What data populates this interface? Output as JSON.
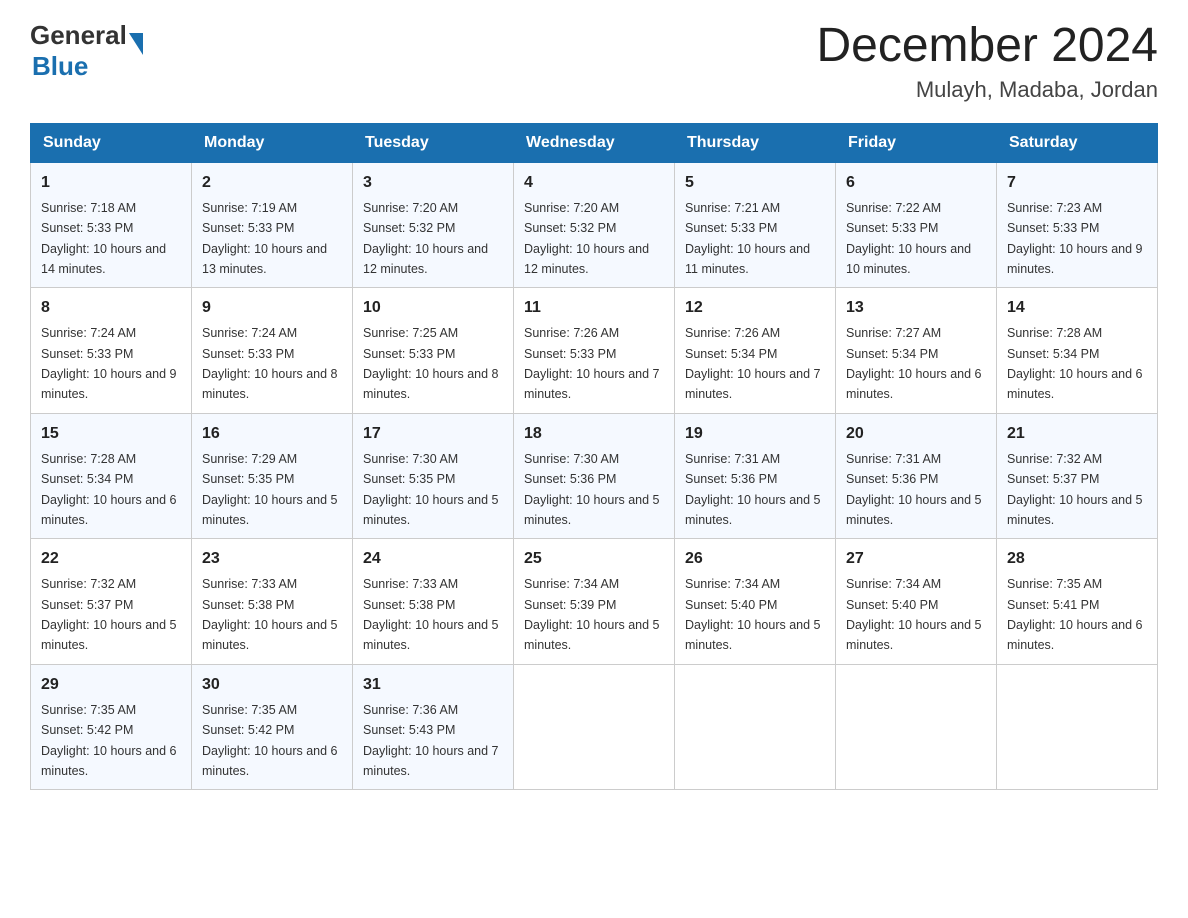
{
  "header": {
    "logo_general": "General",
    "logo_blue": "Blue",
    "month_title": "December 2024",
    "location": "Mulayh, Madaba, Jordan"
  },
  "days_of_week": [
    "Sunday",
    "Monday",
    "Tuesday",
    "Wednesday",
    "Thursday",
    "Friday",
    "Saturday"
  ],
  "weeks": [
    [
      {
        "day": "1",
        "sunrise": "7:18 AM",
        "sunset": "5:33 PM",
        "daylight": "10 hours and 14 minutes."
      },
      {
        "day": "2",
        "sunrise": "7:19 AM",
        "sunset": "5:33 PM",
        "daylight": "10 hours and 13 minutes."
      },
      {
        "day": "3",
        "sunrise": "7:20 AM",
        "sunset": "5:32 PM",
        "daylight": "10 hours and 12 minutes."
      },
      {
        "day": "4",
        "sunrise": "7:20 AM",
        "sunset": "5:32 PM",
        "daylight": "10 hours and 12 minutes."
      },
      {
        "day": "5",
        "sunrise": "7:21 AM",
        "sunset": "5:33 PM",
        "daylight": "10 hours and 11 minutes."
      },
      {
        "day": "6",
        "sunrise": "7:22 AM",
        "sunset": "5:33 PM",
        "daylight": "10 hours and 10 minutes."
      },
      {
        "day": "7",
        "sunrise": "7:23 AM",
        "sunset": "5:33 PM",
        "daylight": "10 hours and 9 minutes."
      }
    ],
    [
      {
        "day": "8",
        "sunrise": "7:24 AM",
        "sunset": "5:33 PM",
        "daylight": "10 hours and 9 minutes."
      },
      {
        "day": "9",
        "sunrise": "7:24 AM",
        "sunset": "5:33 PM",
        "daylight": "10 hours and 8 minutes."
      },
      {
        "day": "10",
        "sunrise": "7:25 AM",
        "sunset": "5:33 PM",
        "daylight": "10 hours and 8 minutes."
      },
      {
        "day": "11",
        "sunrise": "7:26 AM",
        "sunset": "5:33 PM",
        "daylight": "10 hours and 7 minutes."
      },
      {
        "day": "12",
        "sunrise": "7:26 AM",
        "sunset": "5:34 PM",
        "daylight": "10 hours and 7 minutes."
      },
      {
        "day": "13",
        "sunrise": "7:27 AM",
        "sunset": "5:34 PM",
        "daylight": "10 hours and 6 minutes."
      },
      {
        "day": "14",
        "sunrise": "7:28 AM",
        "sunset": "5:34 PM",
        "daylight": "10 hours and 6 minutes."
      }
    ],
    [
      {
        "day": "15",
        "sunrise": "7:28 AM",
        "sunset": "5:34 PM",
        "daylight": "10 hours and 6 minutes."
      },
      {
        "day": "16",
        "sunrise": "7:29 AM",
        "sunset": "5:35 PM",
        "daylight": "10 hours and 5 minutes."
      },
      {
        "day": "17",
        "sunrise": "7:30 AM",
        "sunset": "5:35 PM",
        "daylight": "10 hours and 5 minutes."
      },
      {
        "day": "18",
        "sunrise": "7:30 AM",
        "sunset": "5:36 PM",
        "daylight": "10 hours and 5 minutes."
      },
      {
        "day": "19",
        "sunrise": "7:31 AM",
        "sunset": "5:36 PM",
        "daylight": "10 hours and 5 minutes."
      },
      {
        "day": "20",
        "sunrise": "7:31 AM",
        "sunset": "5:36 PM",
        "daylight": "10 hours and 5 minutes."
      },
      {
        "day": "21",
        "sunrise": "7:32 AM",
        "sunset": "5:37 PM",
        "daylight": "10 hours and 5 minutes."
      }
    ],
    [
      {
        "day": "22",
        "sunrise": "7:32 AM",
        "sunset": "5:37 PM",
        "daylight": "10 hours and 5 minutes."
      },
      {
        "day": "23",
        "sunrise": "7:33 AM",
        "sunset": "5:38 PM",
        "daylight": "10 hours and 5 minutes."
      },
      {
        "day": "24",
        "sunrise": "7:33 AM",
        "sunset": "5:38 PM",
        "daylight": "10 hours and 5 minutes."
      },
      {
        "day": "25",
        "sunrise": "7:34 AM",
        "sunset": "5:39 PM",
        "daylight": "10 hours and 5 minutes."
      },
      {
        "day": "26",
        "sunrise": "7:34 AM",
        "sunset": "5:40 PM",
        "daylight": "10 hours and 5 minutes."
      },
      {
        "day": "27",
        "sunrise": "7:34 AM",
        "sunset": "5:40 PM",
        "daylight": "10 hours and 5 minutes."
      },
      {
        "day": "28",
        "sunrise": "7:35 AM",
        "sunset": "5:41 PM",
        "daylight": "10 hours and 6 minutes."
      }
    ],
    [
      {
        "day": "29",
        "sunrise": "7:35 AM",
        "sunset": "5:42 PM",
        "daylight": "10 hours and 6 minutes."
      },
      {
        "day": "30",
        "sunrise": "7:35 AM",
        "sunset": "5:42 PM",
        "daylight": "10 hours and 6 minutes."
      },
      {
        "day": "31",
        "sunrise": "7:36 AM",
        "sunset": "5:43 PM",
        "daylight": "10 hours and 7 minutes."
      },
      null,
      null,
      null,
      null
    ]
  ],
  "sunrise_label": "Sunrise:",
  "sunset_label": "Sunset:",
  "daylight_label": "Daylight:"
}
